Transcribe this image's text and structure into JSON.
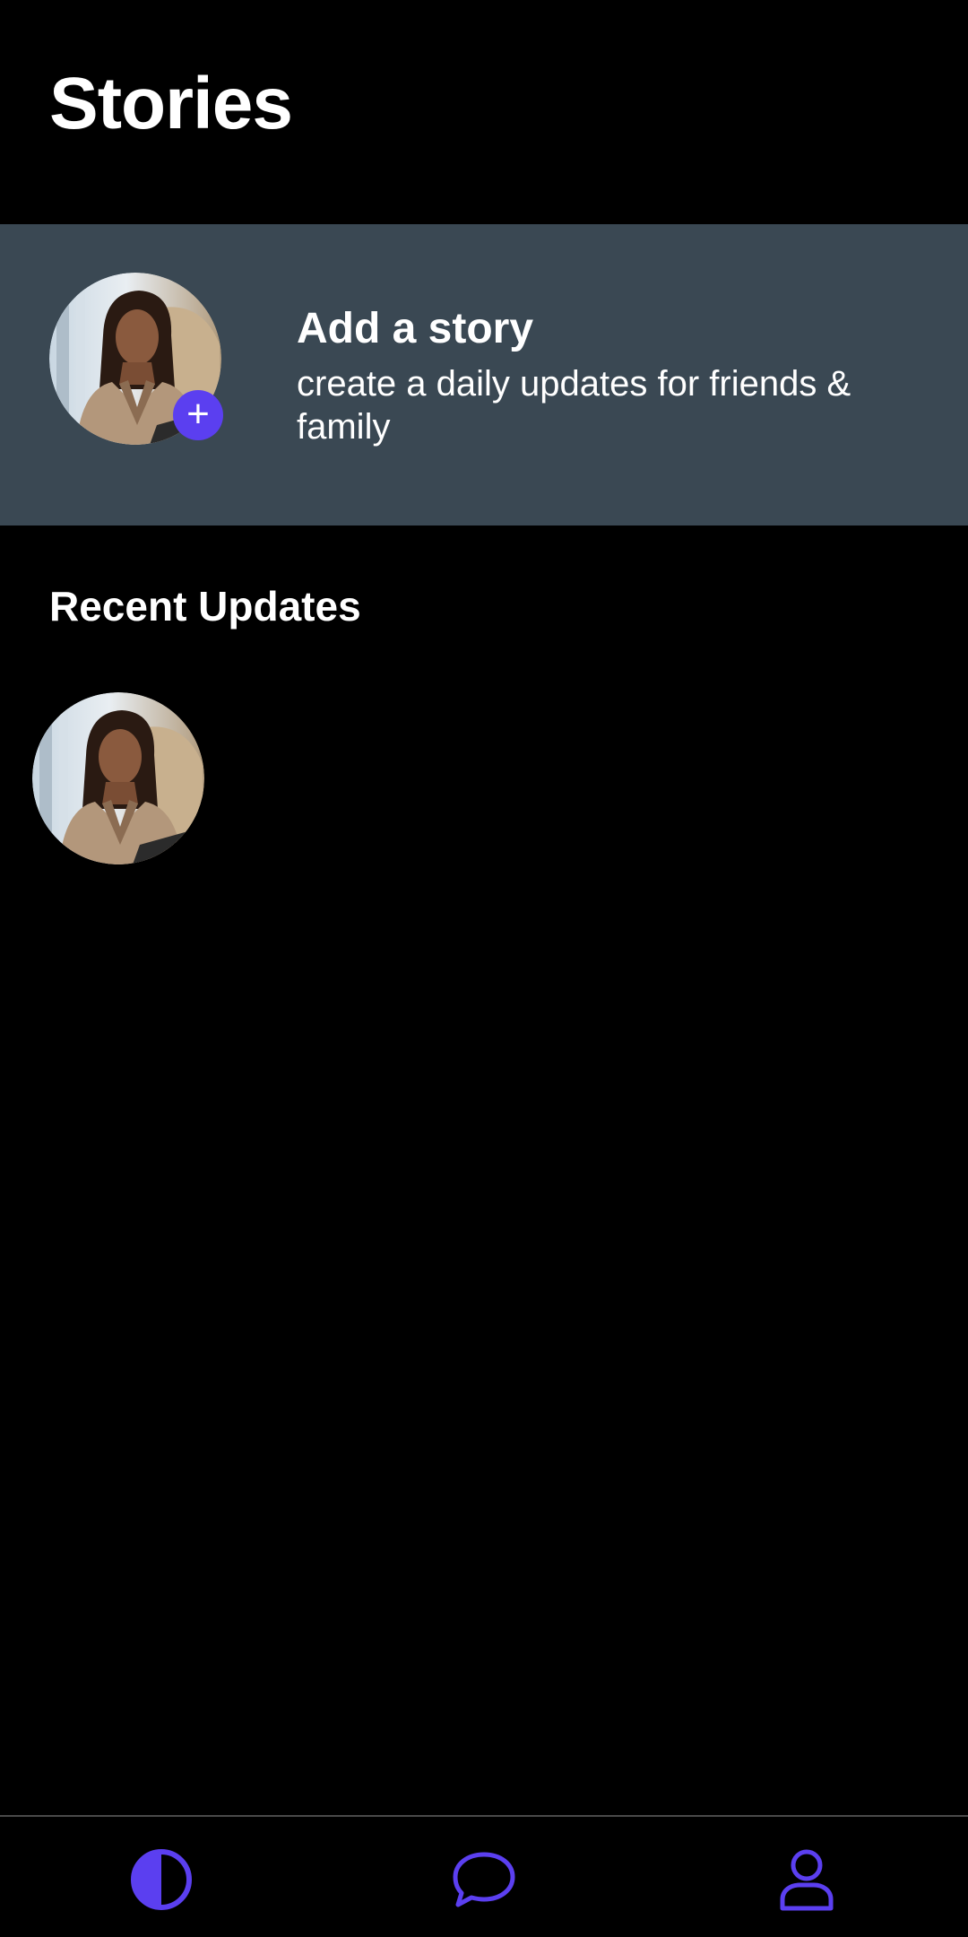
{
  "header": {
    "title": "Stories"
  },
  "add_story": {
    "title": "Add a story",
    "subtitle": "create a daily updates for friends & family",
    "badge": "+",
    "avatar_icon": "user-photo-avatar"
  },
  "recent": {
    "section_title": "Recent Updates",
    "items": [
      {
        "avatar_icon": "user-photo-avatar"
      }
    ]
  },
  "bottom_nav": {
    "items": [
      {
        "icon": "half-circle-icon",
        "name": "stories"
      },
      {
        "icon": "chat-bubble-icon",
        "name": "chats"
      },
      {
        "icon": "person-icon",
        "name": "profile"
      }
    ]
  },
  "colors": {
    "background": "#000000",
    "card": "#3a4853",
    "accent": "#5b3ff0",
    "text": "#ffffff"
  }
}
